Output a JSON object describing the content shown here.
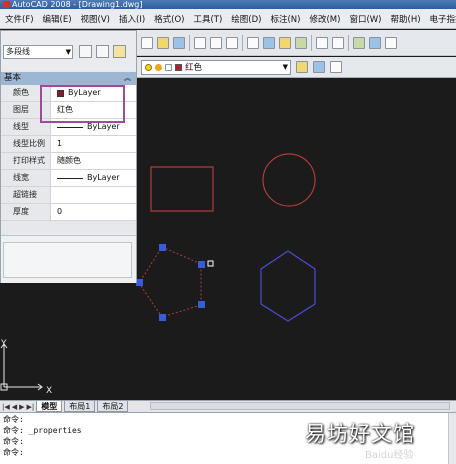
{
  "window": {
    "title": "AutoCAD 2008 - [Drawing1.dwg]"
  },
  "menu": {
    "items": [
      "文件(F)",
      "编辑(E)",
      "视图(V)",
      "插入(I)",
      "格式(O)",
      "工具(T)",
      "绘图(D)",
      "标注(N)",
      "修改(M)",
      "窗口(W)",
      "帮助(H)",
      "电子指批(..."
    ]
  },
  "layer_toolbar": {
    "current_layer": "红色"
  },
  "properties": {
    "object_type": "多段线",
    "section_title": "基本",
    "rows": [
      {
        "label": "颜色",
        "value": "ByLayer"
      },
      {
        "label": "图层",
        "value": "红色"
      },
      {
        "label": "线型",
        "value": "ByLayer"
      },
      {
        "label": "线型比例",
        "value": "1"
      },
      {
        "label": "打印样式",
        "value": "随颜色"
      },
      {
        "label": "线宽",
        "value": "ByLayer"
      },
      {
        "label": "超链接",
        "value": ""
      },
      {
        "label": "厚度",
        "value": "0"
      }
    ]
  },
  "ucs": {
    "x_label": "X",
    "y_label": "Y"
  },
  "tabs": {
    "model": "模型",
    "layout1": "布局1",
    "layout2": "布局2"
  },
  "command": {
    "lines": [
      "命令:",
      "命令: _properties",
      "命令:",
      "命令:"
    ]
  },
  "watermark": {
    "text": "易坊好文馆",
    "small": "Baidu经验"
  },
  "colors": {
    "canvas_bg": "#1b1b1b",
    "red_layer": "#b23b3b",
    "blue_layer": "#4c4cd6",
    "grip": "#3a5bd9",
    "highlight": "#a04a9c"
  },
  "icons": [
    "bulb-icon",
    "sun-icon",
    "lock-icon",
    "color-swatch-icon",
    "select-objects-icon",
    "quick-select-icon",
    "toggle-pickadd-icon",
    "save-icon",
    "undo-icon",
    "redo-icon",
    "pan-icon",
    "zoom-icon"
  ]
}
